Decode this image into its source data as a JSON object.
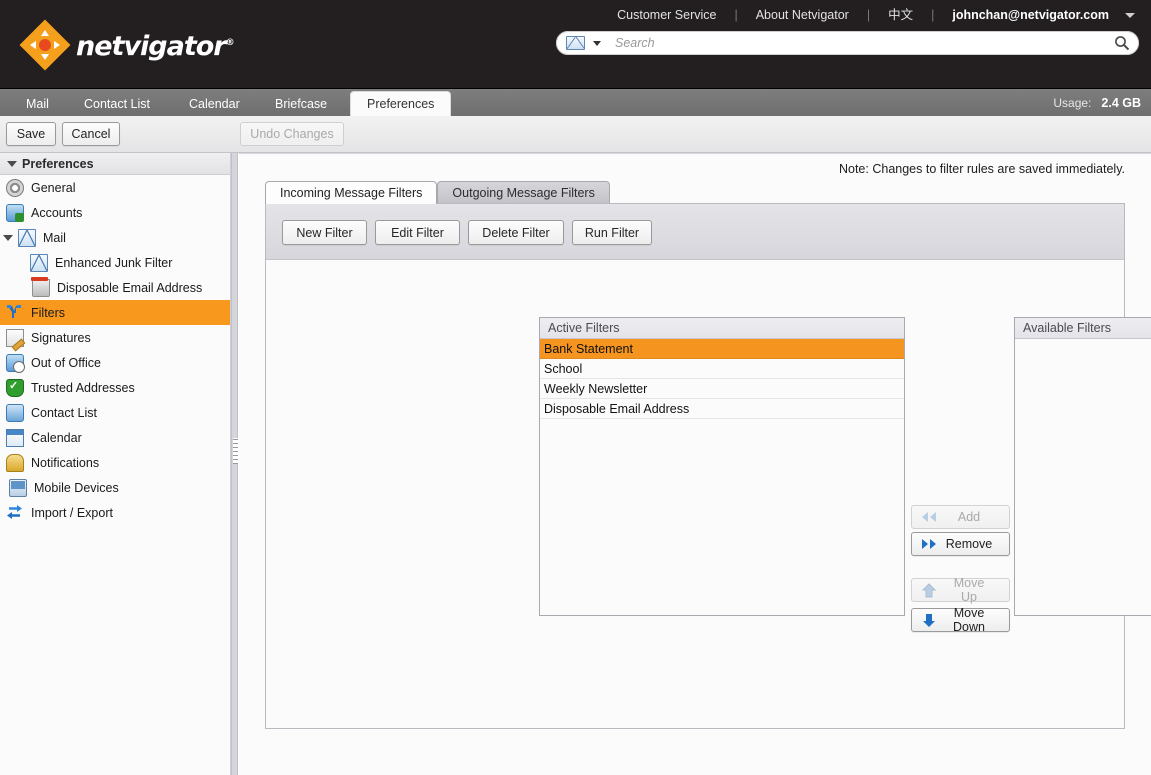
{
  "brand": {
    "logo_text_1": "net",
    "logo_text_2": "vigator",
    "logo_registered": "®"
  },
  "topnav": {
    "links": [
      {
        "label": "Customer Service",
        "name": "customer-service-link"
      },
      {
        "label": "About Netvigator",
        "name": "about-netvigator-link"
      },
      {
        "label": "中文",
        "name": "language-chinese-link"
      }
    ],
    "separator": "|",
    "user_email": "johnchan@netvigator.com"
  },
  "search": {
    "placeholder": "Search",
    "value": "",
    "scope_icon": "mail-icon"
  },
  "apptabs": {
    "items": [
      {
        "label": "Mail",
        "name": "tab-mail",
        "active": false
      },
      {
        "label": "Contact List",
        "name": "tab-contact-list",
        "active": false
      },
      {
        "label": "Calendar",
        "name": "tab-calendar",
        "active": false
      },
      {
        "label": "Briefcase",
        "name": "tab-briefcase",
        "active": false
      },
      {
        "label": "Preferences",
        "name": "tab-preferences",
        "active": true
      }
    ],
    "usage_label": "Usage:",
    "usage_value": "2.4 GB"
  },
  "actionbar": {
    "save_label": "Save",
    "cancel_label": "Cancel",
    "undo_label": "Undo Changes"
  },
  "sidebar": {
    "header": "Preferences",
    "items": [
      {
        "label": "General",
        "icon": "gear-icon",
        "selected": false
      },
      {
        "label": "Accounts",
        "icon": "accounts-icon",
        "selected": false
      },
      {
        "label": "Mail",
        "icon": "mail-icon",
        "selected": false
      },
      {
        "label": "Enhanced Junk Filter",
        "icon": "mail-icon",
        "selected": false
      },
      {
        "label": "Disposable Email Address",
        "icon": "trash-icon",
        "selected": false
      },
      {
        "label": "Filters",
        "icon": "filter-icon",
        "selected": true
      },
      {
        "label": "Signatures",
        "icon": "signature-icon",
        "selected": false
      },
      {
        "label": "Out of Office",
        "icon": "out-of-office-icon",
        "selected": false
      },
      {
        "label": "Trusted Addresses",
        "icon": "shield-check-icon",
        "selected": false
      },
      {
        "label": "Contact List",
        "icon": "contact-icon",
        "selected": false
      },
      {
        "label": "Calendar",
        "icon": "calendar-icon",
        "selected": false
      },
      {
        "label": "Notifications",
        "icon": "bell-icon",
        "selected": false
      },
      {
        "label": "Mobile Devices",
        "icon": "mobile-icon",
        "selected": false
      },
      {
        "label": "Import / Export",
        "icon": "import-export-icon",
        "selected": false
      }
    ]
  },
  "main": {
    "note": "Note: Changes to filter rules are saved immediately.",
    "tabs": [
      {
        "label": "Incoming Message Filters",
        "name": "tab-incoming-message-filters",
        "active": true
      },
      {
        "label": "Outgoing Message Filters",
        "name": "tab-outgoing-message-filters",
        "active": false
      }
    ],
    "toolbar": {
      "new_filter": "New Filter",
      "edit_filter": "Edit Filter",
      "delete_filter": "Delete Filter",
      "run_filter": "Run Filter"
    },
    "active_filters": {
      "header": "Active Filters",
      "rows": [
        {
          "label": "Bank Statement",
          "selected": true
        },
        {
          "label": "School",
          "selected": false
        },
        {
          "label": "Weekly Newsletter",
          "selected": false
        },
        {
          "label": "Disposable Email Address",
          "selected": false
        }
      ]
    },
    "available_filters": {
      "header": "Available Filters",
      "rows": []
    },
    "transfer": {
      "add": {
        "label": "Add",
        "icon": "double-arrow-left-icon",
        "disabled": true
      },
      "remove": {
        "label": "Remove",
        "icon": "double-arrow-right-icon",
        "disabled": false
      },
      "move_up": {
        "label": "Move Up",
        "icon": "arrow-up-icon",
        "disabled": true
      },
      "move_down": {
        "label": "Move Down",
        "icon": "arrow-down-icon",
        "disabled": false
      }
    }
  },
  "colors": {
    "brand_orange": "#f5941f",
    "selection_orange": "#f8981d",
    "topbar_black": "#231f20",
    "tabbar_gray": "#757575",
    "accent_blue": "#1f6fc4"
  }
}
